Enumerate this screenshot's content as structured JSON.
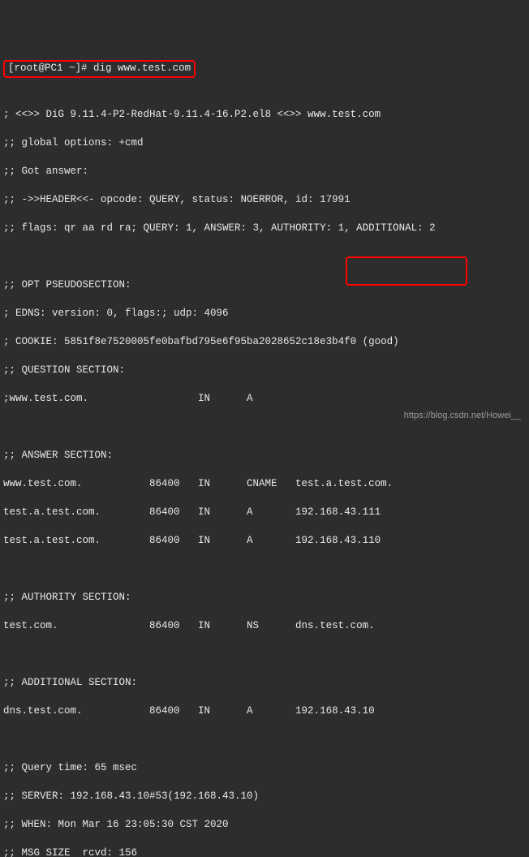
{
  "prompt": {
    "user_host": "[root@PC1 ~]#",
    "command": "dig www.test.com"
  },
  "output": {
    "banner": "; <<>> DiG 9.11.4-P2-RedHat-9.11.4-16.P2.el8 <<>> www.test.com",
    "global_options": ";; global options: +cmd",
    "got_answer": ";; Got answer:",
    "header": ";; ->>HEADER<<- opcode: QUERY, status: NOERROR, id: 17991",
    "flags": ";; flags: qr aa rd ra; QUERY: 1, ANSWER: 3, AUTHORITY: 1, ADDITIONAL: 2",
    "opt_header": ";; OPT PSEUDOSECTION:",
    "edns": "; EDNS: version: 0, flags:; udp: 4096",
    "cookie": "; COOKIE: 5851f8e7520005fe0bafbd795e6f95ba2028652c18e3b4f0 (good)",
    "question_header": ";; QUESTION SECTION:",
    "question": ";www.test.com.                  IN      A",
    "answer_header": ";; ANSWER SECTION:",
    "answer1": "www.test.com.           86400   IN      CNAME   test.a.test.com.",
    "answer2": "test.a.test.com.        86400   IN      A       192.168.43.111",
    "answer3": "test.a.test.com.        86400   IN      A       192.168.43.110",
    "authority_header": ";; AUTHORITY SECTION:",
    "authority": "test.com.               86400   IN      NS      dns.test.com.",
    "additional_header": ";; ADDITIONAL SECTION:",
    "additional": "dns.test.com.           86400   IN      A       192.168.43.10",
    "query_time": ";; Query time: 65 msec",
    "server": ";; SERVER: 192.168.43.10#53(192.168.43.10)",
    "when": ";; WHEN: Mon Mar 16 23:05:30 CST 2020",
    "msg_size": ";; MSG SIZE  rcvd: 156"
  },
  "watermark": "https://blog.csdn.net/Howei__"
}
